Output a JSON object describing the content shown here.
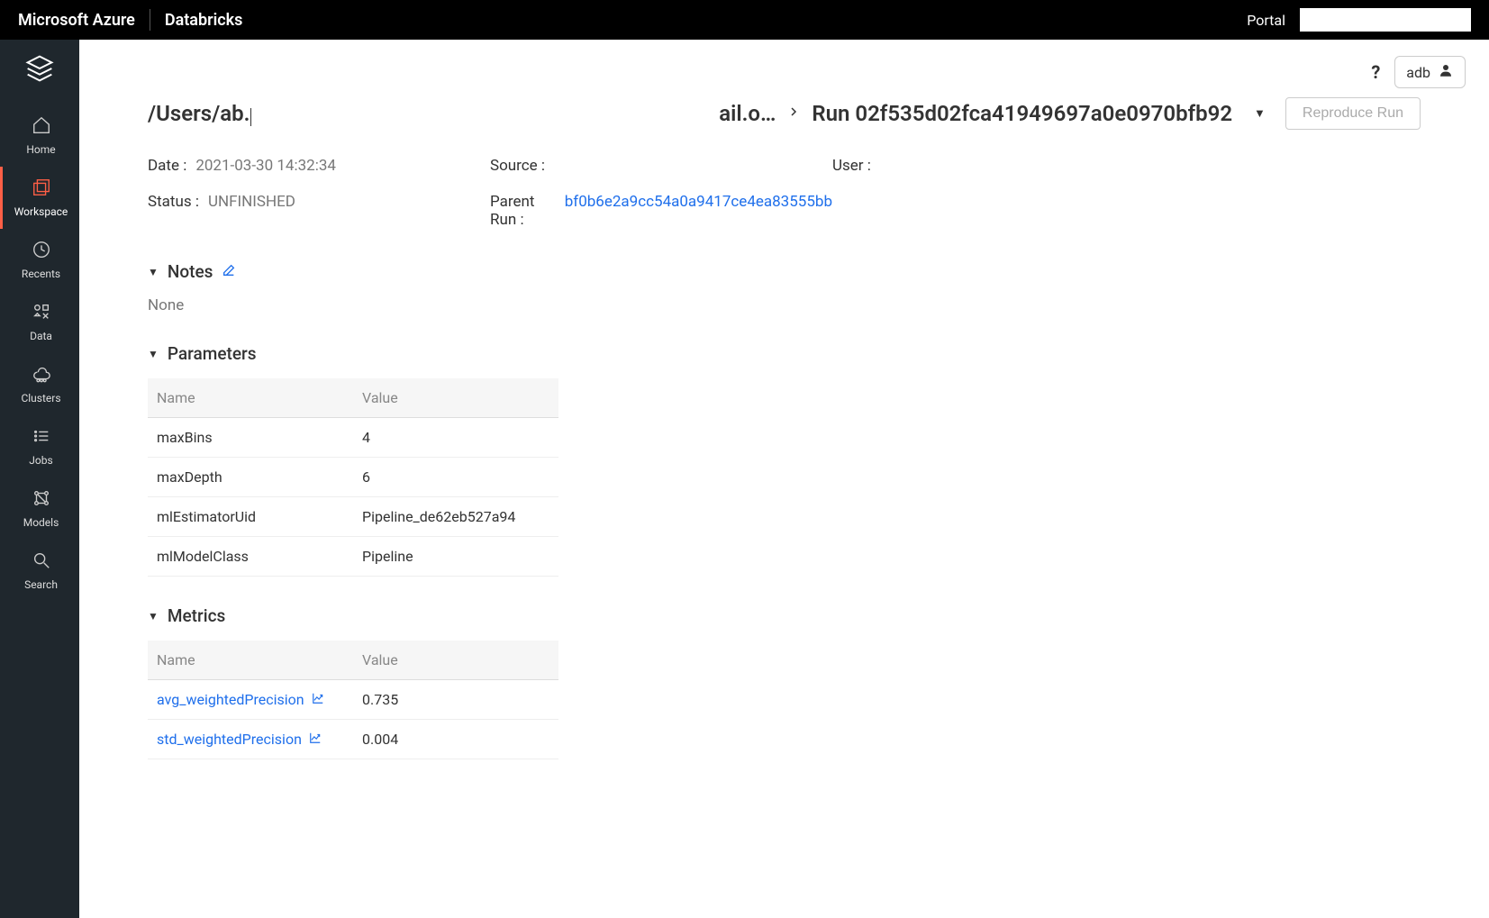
{
  "topbar": {
    "brand": "Microsoft Azure",
    "product": "Databricks",
    "portal": "Portal"
  },
  "sidebar": {
    "items": [
      {
        "label": "Home"
      },
      {
        "label": "Workspace"
      },
      {
        "label": "Recents"
      },
      {
        "label": "Data"
      },
      {
        "label": "Clusters"
      },
      {
        "label": "Jobs"
      },
      {
        "label": "Models"
      },
      {
        "label": "Search"
      }
    ]
  },
  "header": {
    "user": "adb"
  },
  "breadcrumb": {
    "path_prefix": "/Users/ab.",
    "overflow": "ail.o…",
    "run_label": "Run 02f535d02fca41949697a0e0970bfb92",
    "reproduce_label": "Reproduce Run"
  },
  "meta": {
    "date_label": "Date :",
    "date_value": "2021-03-30 14:32:34",
    "source_label": "Source :",
    "source_value": "",
    "user_label": "User :",
    "user_value": "",
    "status_label": "Status :",
    "status_value": "UNFINISHED",
    "parent_label": "Parent Run :",
    "parent_link": "bf0b6e2a9cc54a0a9417ce4ea83555bb"
  },
  "sections": {
    "notes_title": "Notes",
    "notes_value": "None",
    "parameters_title": "Parameters",
    "metrics_title": "Metrics",
    "col_name": "Name",
    "col_value": "Value"
  },
  "parameters": [
    {
      "name": "maxBins",
      "value": "4"
    },
    {
      "name": "maxDepth",
      "value": "6"
    },
    {
      "name": "mlEstimatorUid",
      "value": "Pipeline_de62eb527a94"
    },
    {
      "name": "mlModelClass",
      "value": "Pipeline"
    }
  ],
  "metrics": [
    {
      "name": "avg_weightedPrecision",
      "value": "0.735"
    },
    {
      "name": "std_weightedPrecision",
      "value": "0.004"
    }
  ]
}
